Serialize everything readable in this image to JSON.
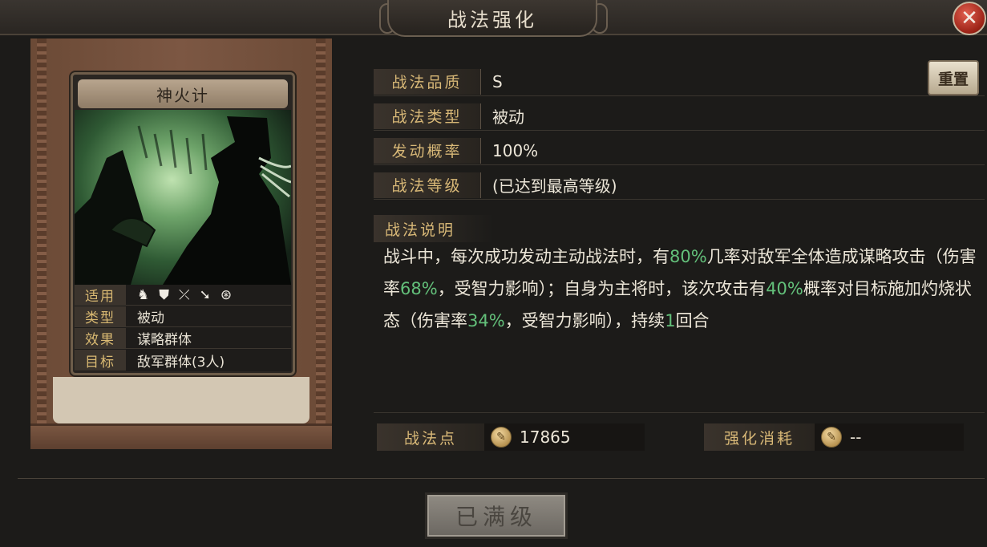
{
  "window": {
    "title": "战法强化",
    "close": "✕"
  },
  "card": {
    "name": "神火计",
    "info": [
      {
        "key": "适用",
        "val": ""
      },
      {
        "key": "类型",
        "val": "被动"
      },
      {
        "key": "效果",
        "val": "谋略群体"
      },
      {
        "key": "目标",
        "val": "敌军群体(3人)"
      }
    ],
    "unit_icons": [
      "cavalry-icon",
      "shield-icon",
      "bow-icon",
      "spear-icon",
      "wheel-icon"
    ]
  },
  "attributes": [
    {
      "key": "战法品质",
      "val": "S"
    },
    {
      "key": "战法类型",
      "val": "被动"
    },
    {
      "key": "发动概率",
      "val": "100%"
    },
    {
      "key": "战法等级",
      "val": "(已达到最高等级)"
    }
  ],
  "reset_label": "重置",
  "description": {
    "title": "战法说明",
    "segments": [
      {
        "t": "战斗中，每次成功发动主动战法时，有"
      },
      {
        "t": "80%",
        "hl": true
      },
      {
        "t": "几率对敌军全体造成谋略攻击（伤害率"
      },
      {
        "t": "68%",
        "hl": true
      },
      {
        "t": "，受智力影响）；自身为主将时，该次攻击有"
      },
      {
        "t": "40%",
        "hl": true
      },
      {
        "t": "概率对目标施加灼烧状态（伤害率"
      },
      {
        "t": "34%",
        "hl": true
      },
      {
        "t": "，受智力影响），持续"
      },
      {
        "t": "1",
        "hl": true
      },
      {
        "t": "回合"
      }
    ]
  },
  "points": {
    "label": "战法点",
    "value": "17865"
  },
  "cost": {
    "label": "强化消耗",
    "value": "--"
  },
  "max_button": "已满级",
  "colors": {
    "highlight": "#63c07a",
    "gold_label": "#d8b877"
  }
}
